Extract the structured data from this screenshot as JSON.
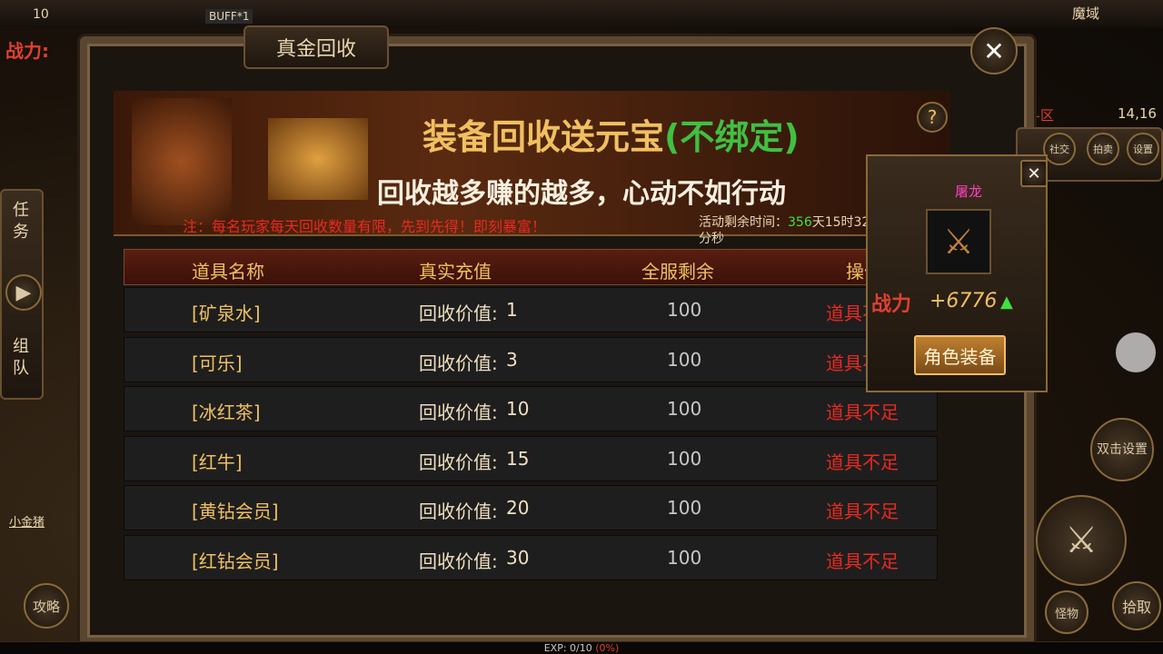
{
  "hud": {
    "level": "10",
    "buff": "BUFF*1",
    "map_name": "魔域",
    "combat_power": "战力:",
    "zone": "斗区",
    "coords": "14,16",
    "player_name": "小金猪",
    "guide": "攻略",
    "exp": "EXP: 0/10 ",
    "exp_pct": "(0%)"
  },
  "side": {
    "task": "任务",
    "team": "组队"
  },
  "window": {
    "title": "真金回收"
  },
  "banner": {
    "title": "装备回收送元宝",
    "title_suffix": "(不绑定)",
    "subtitle": "回收越多赚的越多，心动不如行动",
    "notice": "注：每名玩家每天回收数量有限，先到先得！即刻暴富！",
    "countdown_label": "活动剩余时间：",
    "countdown_days": "356",
    "countdown_rest": "天15时32分秒"
  },
  "table": {
    "headers": [
      "道具名称",
      "真实充值",
      "全服剩余",
      "操作"
    ],
    "value_prefix": "回收价值:",
    "rows": [
      {
        "name": "[矿泉水]",
        "value": "1",
        "remaining": "100",
        "status": "道具不足"
      },
      {
        "name": "[可乐]",
        "value": "3",
        "remaining": "100",
        "status": "道具不足"
      },
      {
        "name": "[冰红茶]",
        "value": "10",
        "remaining": "100",
        "status": "道具不足"
      },
      {
        "name": "[红牛]",
        "value": "15",
        "remaining": "100",
        "status": "道具不足"
      },
      {
        "name": "[黄钻会员]",
        "value": "20",
        "remaining": "100",
        "status": "道具不足"
      },
      {
        "name": "[红钻会员]",
        "value": "30",
        "remaining": "100",
        "status": "道具不足"
      }
    ]
  },
  "popup": {
    "item_name": "屠龙",
    "power_label": "战力",
    "power_value": "+6776",
    "button": "角色装备"
  },
  "right": {
    "social": "社交",
    "auction": "拍卖",
    "settings": "设置",
    "dbl_settings": "双击设置",
    "monster": "怪物",
    "pickup": "拾取"
  },
  "colors": {
    "gold_text": "#f0c060",
    "status_red": "#e82a20",
    "highlight_green": "#40e040",
    "item_pink": "#ff40c0"
  }
}
